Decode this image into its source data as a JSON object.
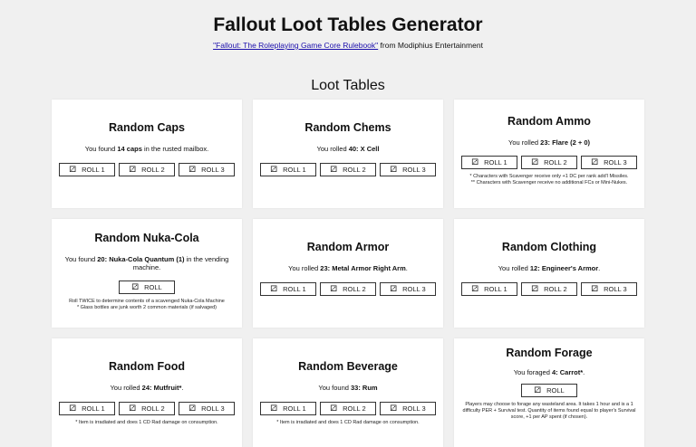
{
  "header": {
    "title": "Fallout Loot Tables Generator",
    "source_link": "\"Fallout: The Roleplaying Game Core Rulebook\"",
    "source_suffix": " from Modiphius Entertainment"
  },
  "section_title": "Loot Tables",
  "icons": {
    "dice": "dice-icon"
  },
  "cards": {
    "caps": {
      "title": "Random Caps",
      "pre": "You found ",
      "value": "14 caps",
      "post": " in the rusted mailbox.",
      "buttons": [
        "ROLL 1",
        "ROLL 2",
        "ROLL 3"
      ]
    },
    "chems": {
      "title": "Random Chems",
      "pre": "You rolled ",
      "value": "40: X Cell",
      "post": "",
      "buttons": [
        "ROLL 1",
        "ROLL 2",
        "ROLL 3"
      ]
    },
    "ammo": {
      "title": "Random Ammo",
      "pre": "You rolled ",
      "value": "23: Flare (2 + 0)",
      "post": "",
      "buttons": [
        "ROLL 1",
        "ROLL 2",
        "ROLL 3"
      ],
      "notes": [
        "* Characters with Scavenger receive only +1 DC per rank add'l Missiles.",
        "** Characters with Scavenger receive no additional FCs or Mini-Nukes."
      ]
    },
    "nuka": {
      "title": "Random Nuka-Cola",
      "pre": "You found ",
      "value": "20: Nuka-Cola Quantum (1)",
      "post": " in the vending machine.",
      "buttons": [
        "ROLL"
      ],
      "notes": [
        "Roll TWICE to determine contents of a scavenged Nuka-Cola Machine",
        "* Glass bottles are junk worth 2 common materials (if salvaged)"
      ]
    },
    "armor": {
      "title": "Random Armor",
      "pre": "You rolled ",
      "value": "23: Metal Armor Right Arm",
      "post": ".",
      "buttons": [
        "ROLL 1",
        "ROLL 2",
        "ROLL 3"
      ]
    },
    "clothing": {
      "title": "Random Clothing",
      "pre": "You rolled ",
      "value": "12: Engineer's Armor",
      "post": ".",
      "buttons": [
        "ROLL 1",
        "ROLL 2",
        "ROLL 3"
      ]
    },
    "food": {
      "title": "Random Food",
      "pre": "You rolled ",
      "value": "24: Mutfruit*",
      "post": ".",
      "buttons": [
        "ROLL 1",
        "ROLL 2",
        "ROLL 3"
      ],
      "notes": [
        "* Item is irradiated and does 1 CD Rad damage on consumption."
      ]
    },
    "beverage": {
      "title": "Random Beverage",
      "pre": "You found ",
      "value": "33: Rum",
      "post": "",
      "buttons": [
        "ROLL 1",
        "ROLL 2",
        "ROLL 3"
      ],
      "notes": [
        "* Item is irradiated and does 1 CD Rad damage on consumption."
      ]
    },
    "forage": {
      "title": "Random Forage",
      "pre": "You foraged ",
      "value": "4: Carrot*",
      "post": ".",
      "buttons": [
        "ROLL"
      ],
      "notes": [
        "Players may choose to forage any wasteland area. It takes 1 hour and is a 1 difficulty PER + Survival test. Quantity of items found equal to player's Survival score, +1 per AP spent (if chosen)."
      ]
    }
  }
}
